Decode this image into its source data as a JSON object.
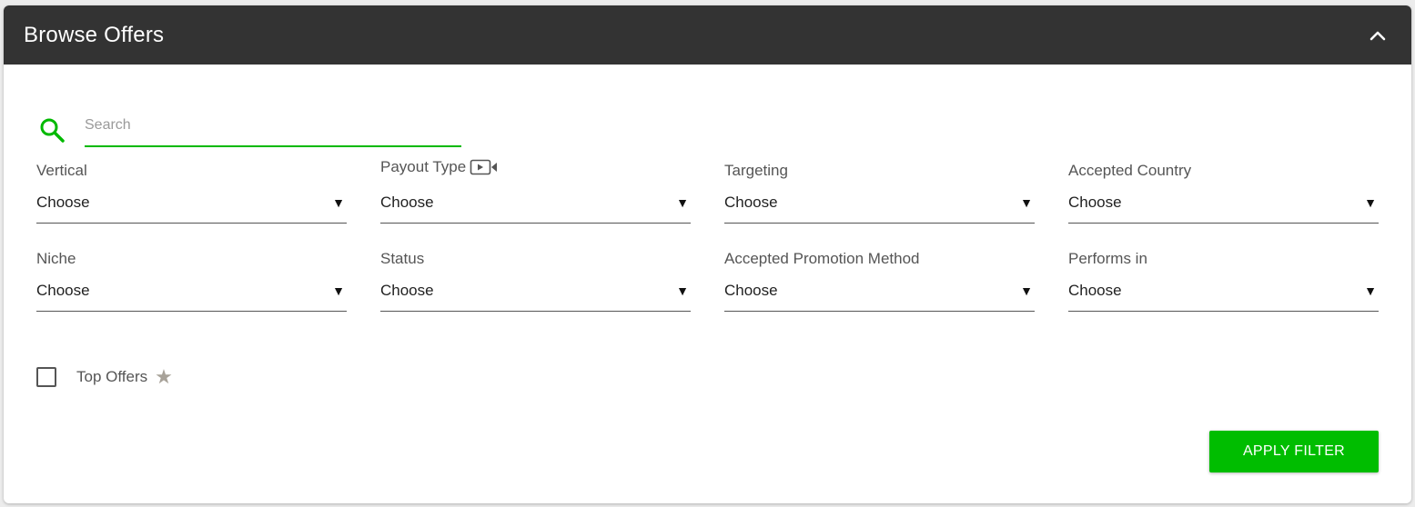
{
  "header": {
    "title": "Browse Offers",
    "collapse_icon": "chevron-up-icon"
  },
  "search": {
    "placeholder": "Search",
    "value": "",
    "icon": "search-icon",
    "accent_color": "#00b900"
  },
  "filters": [
    {
      "label": "Vertical",
      "value": "Choose"
    },
    {
      "label": "Payout Type",
      "value": "Choose",
      "icon": "video-icon"
    },
    {
      "label": "Targeting",
      "value": "Choose"
    },
    {
      "label": "Accepted Country",
      "value": "Choose"
    },
    {
      "label": "Niche",
      "value": "Choose"
    },
    {
      "label": "Status",
      "value": "Choose"
    },
    {
      "label": "Accepted Promotion Method",
      "value": "Choose"
    },
    {
      "label": "Performs in",
      "value": "Choose"
    }
  ],
  "caret_glyph": "▼",
  "top_offers": {
    "label": "Top Offers",
    "checked": false,
    "star_glyph": "★"
  },
  "apply_button": {
    "label": "APPLY FILTER",
    "color": "#00bd00"
  },
  "colors": {
    "header_bg": "#333333",
    "accent": "#00b900"
  }
}
